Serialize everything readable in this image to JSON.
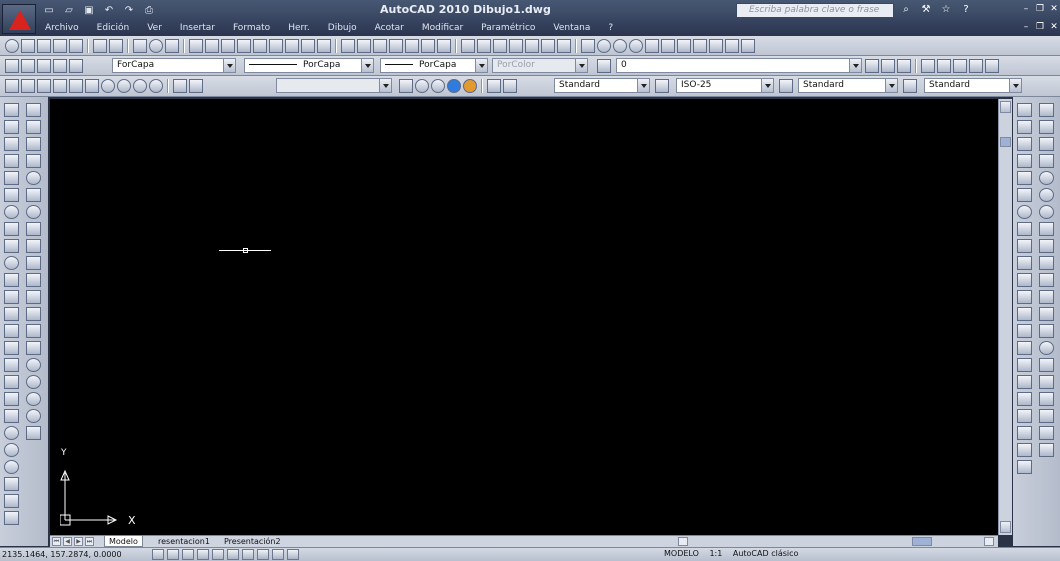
{
  "app": {
    "title": "AutoCAD 2010   Dibujo1.dwg",
    "search_placeholder": "Escriba palabra clave o frase"
  },
  "quick_access": {
    "icons": [
      "new-icon",
      "open-icon",
      "save-icon",
      "undo-icon",
      "redo-icon",
      "print-icon"
    ]
  },
  "menu": {
    "items": [
      "Archivo",
      "Edición",
      "Ver",
      "Insertar",
      "Formato",
      "Herr.",
      "Dibujo",
      "Acotar",
      "Modificar",
      "Paramétrico",
      "Ventana",
      "?"
    ]
  },
  "window_controls": {
    "minimize": "–",
    "restore": "❐",
    "close": "✕"
  },
  "properties_toolbar": {
    "layer": "ForCapa",
    "linetype": "PorCapa",
    "lineweight": "PorCapa",
    "plotstyle": "PorColor",
    "layer_state": "0"
  },
  "styles_toolbar": {
    "text_style": "Standard",
    "dim_style": "ISO-25",
    "table_style": "Standard",
    "multileader_style": "Standard"
  },
  "layout_tabs": {
    "model": "Modelo",
    "layout1": "resentacion1",
    "layout2": "Presentación2"
  },
  "status": {
    "coordinates": "2135.1464, 157.2874, 0.0000",
    "model_label": "MODELO",
    "scale": "1:1",
    "workspace": "AutoCAD clásico"
  },
  "ucs": {
    "x_label": "X",
    "y_label": "Y"
  },
  "colors": {
    "canvas": "#000000",
    "logo": "#d9231e",
    "chrome": "#2b3346"
  }
}
